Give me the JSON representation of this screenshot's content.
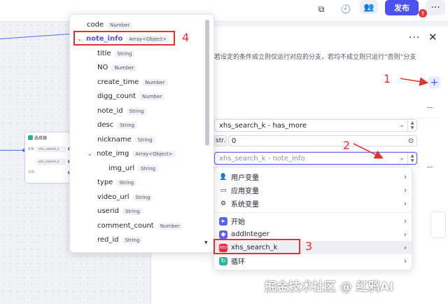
{
  "topbar": {
    "publish_label": "发布",
    "badge_text": "!",
    "more_label": "···"
  },
  "canvas": {
    "node_title": "选择器",
    "node_rows": [
      "xhs_search_k",
      "xhs_search_k"
    ],
    "node_labels": [
      "如果",
      "否则"
    ]
  },
  "panel": {
    "more_label": "···",
    "close_label": "✕",
    "description": "若设定的条件成立则仅运行对应的分支，若均不成立则只运行“否则”分支",
    "add_label": "+",
    "condition1_value": "xhs_search_k - has_more",
    "type_tag": "str.",
    "condition_value_input": "0",
    "condition2_placeholder": "xhs_search_k - note_info"
  },
  "variable_menu": {
    "items": [
      {
        "label": "用户变量",
        "icon": "user-icon"
      },
      {
        "label": "应用变量",
        "icon": "folder-icon"
      },
      {
        "label": "系统变量",
        "icon": "gear-icon"
      },
      {
        "label": "开始",
        "icon": "start-icon",
        "color": "#5b63f5"
      },
      {
        "label": "addInteger",
        "icon": "plugin-icon",
        "color": "#5b63f5"
      },
      {
        "label": "xhs_search_k",
        "icon": "xhs-icon",
        "color": "#ff2442"
      },
      {
        "label": "循环",
        "icon": "loop-icon",
        "color": "#2fb3a0"
      }
    ]
  },
  "field_list": {
    "items": [
      {
        "name": "code",
        "type": "Number"
      },
      {
        "name": "note_info",
        "type": "Array<Object>"
      },
      {
        "name": "title",
        "type": "String"
      },
      {
        "name": "NO",
        "type": "Number"
      },
      {
        "name": "create_time",
        "type": "Number"
      },
      {
        "name": "digg_count",
        "type": "Number"
      },
      {
        "name": "note_id",
        "type": "String"
      },
      {
        "name": "desc",
        "type": "String"
      },
      {
        "name": "nickname",
        "type": "String"
      },
      {
        "name": "note_img",
        "type": "Array<Object>"
      },
      {
        "name": "img_url",
        "type": "String"
      },
      {
        "name": "type",
        "type": "String"
      },
      {
        "name": "video_url",
        "type": "String"
      },
      {
        "name": "userid",
        "type": "String"
      },
      {
        "name": "comment_count",
        "type": "Number"
      },
      {
        "name": "red_id",
        "type": "String"
      }
    ]
  },
  "annotations": {
    "n1": "1",
    "n2": "2",
    "n3": "3",
    "n4": "4",
    "color": "#e4332c"
  },
  "watermark": "掘金技术社区 @ 红鸦AI"
}
